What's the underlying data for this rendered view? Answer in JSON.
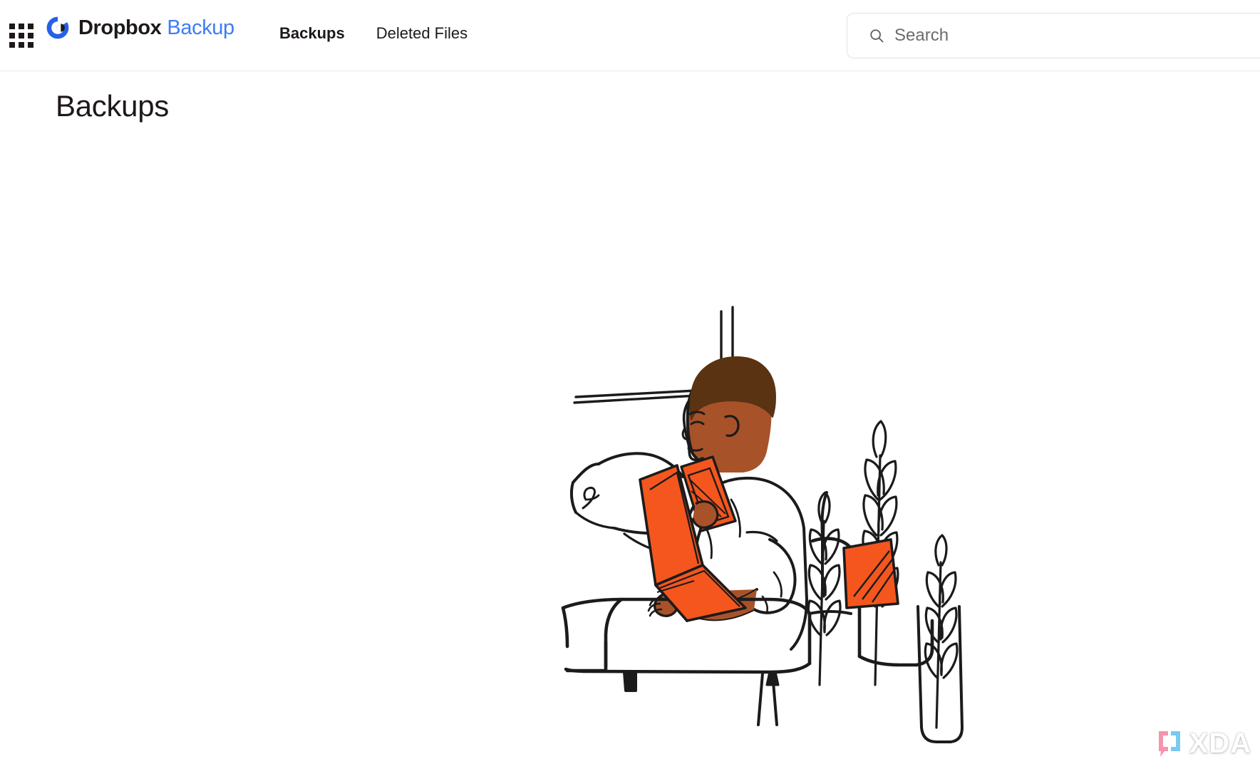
{
  "window": {
    "background": "#ffffff"
  },
  "header": {
    "app_launcher_icon": "grid-apps-icon",
    "brand": {
      "mark_icon": "dropbox-backup-logo-icon",
      "name": "Dropbox",
      "product": "Backup",
      "name_color": "#1e1919",
      "product_color": "#3d7df2"
    },
    "nav": [
      {
        "label": "Backups",
        "active": true
      },
      {
        "label": "Deleted Files",
        "active": false
      }
    ],
    "search": {
      "icon": "search-icon",
      "placeholder": "Search",
      "value": ""
    },
    "border_color": "#e7e7e7"
  },
  "main": {
    "title": "Backups",
    "illustration": {
      "name": "person-on-couch-with-laptop-and-phone-illustration",
      "accent_color": "#f4561e",
      "skin_color": "#a8522a",
      "hair_color": "#5a3312",
      "line_color": "#1b1b1b"
    }
  },
  "watermark": {
    "icon": "xda-bubble-icon",
    "text": "XDA",
    "icon_pink": "#f58ca6",
    "icon_blue": "#6ec6f0",
    "text_color": "#ffffff"
  }
}
